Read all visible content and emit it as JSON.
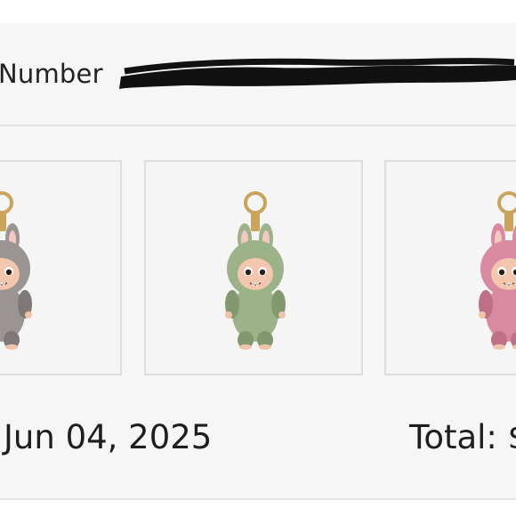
{
  "order": {
    "number_label": "Number"
  },
  "items": [
    {
      "name": "grey-plush-keychain",
      "color": "#9a9592",
      "accent": "#7e7976"
    },
    {
      "name": "green-plush-keychain",
      "color": "#9cb38a",
      "accent": "#82996f"
    },
    {
      "name": "pink-plush-keychain",
      "color": "#d98aa0",
      "accent": "#bf6f86"
    }
  ],
  "summary": {
    "date": "Jun 04, 2025",
    "total_label": "Total: $"
  }
}
